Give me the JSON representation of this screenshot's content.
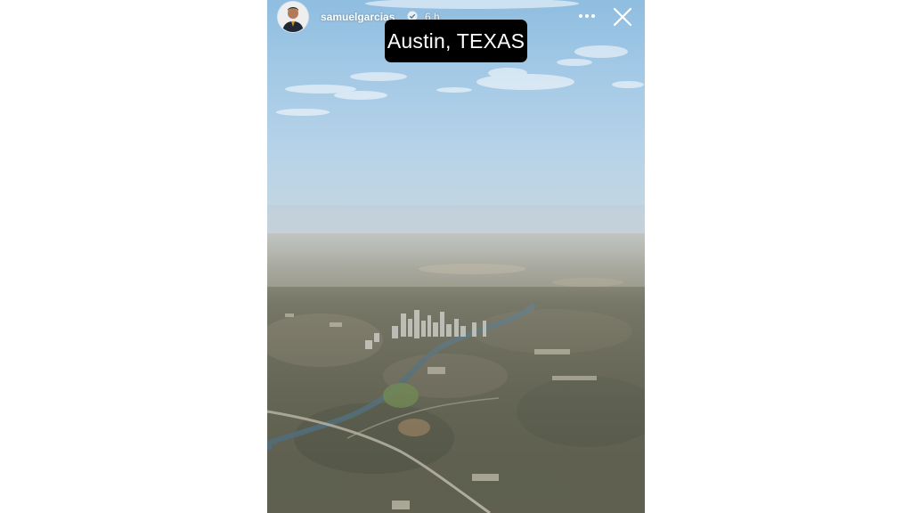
{
  "story": {
    "username": "samuelgarcias",
    "time_ago": "6 h",
    "location_sticker": "Austin, TEXAS",
    "icons": {
      "avatar": "profile-avatar",
      "verified": "verified-badge-icon",
      "more": "more-options-icon",
      "close": "close-icon"
    }
  },
  "colors": {
    "page_background": "#ffffff",
    "sticker_background": "#000000",
    "sticker_text": "#ffffff"
  }
}
